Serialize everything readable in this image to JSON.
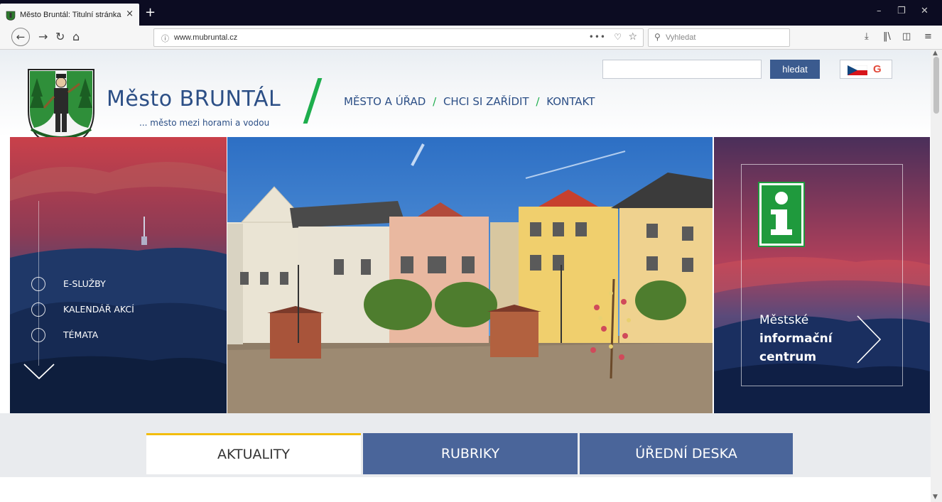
{
  "browser": {
    "tab_title": "Město Bruntál: Titulní stránka",
    "tab_close": "×",
    "new_tab": "+",
    "url": "www.mubruntal.cz",
    "search_placeholder": "Vyhledat",
    "window_controls": [
      "–",
      "❐",
      "✕"
    ]
  },
  "header": {
    "brand": "Město BRUNTÁL",
    "slogan": "... město mezi horami a vodou",
    "nav": [
      "MĚSTO A ÚŘAD",
      "CHCI SI ZAŘÍDIT",
      "KONTAKT"
    ],
    "nav_separator": "/",
    "search_button": "hledat",
    "lang_icon": "G"
  },
  "hero": {
    "left_menu": [
      "E-SLUŽBY",
      "KALENDÁŘ AKCÍ",
      "TÉMATA"
    ],
    "info_line1": "Městské",
    "info_line2": "informační",
    "info_line3": "centrum"
  },
  "tabs": [
    "AKTUALITY",
    "RUBRIKY",
    "ÚŘEDNÍ DESKA"
  ],
  "colors": {
    "brand_blue": "#2c4f86",
    "slash_green": "#1eae4d",
    "tab_blue": "#4a659a",
    "active_tab_accent": "#f2bd0d",
    "info_green": "#1f9a3d"
  }
}
